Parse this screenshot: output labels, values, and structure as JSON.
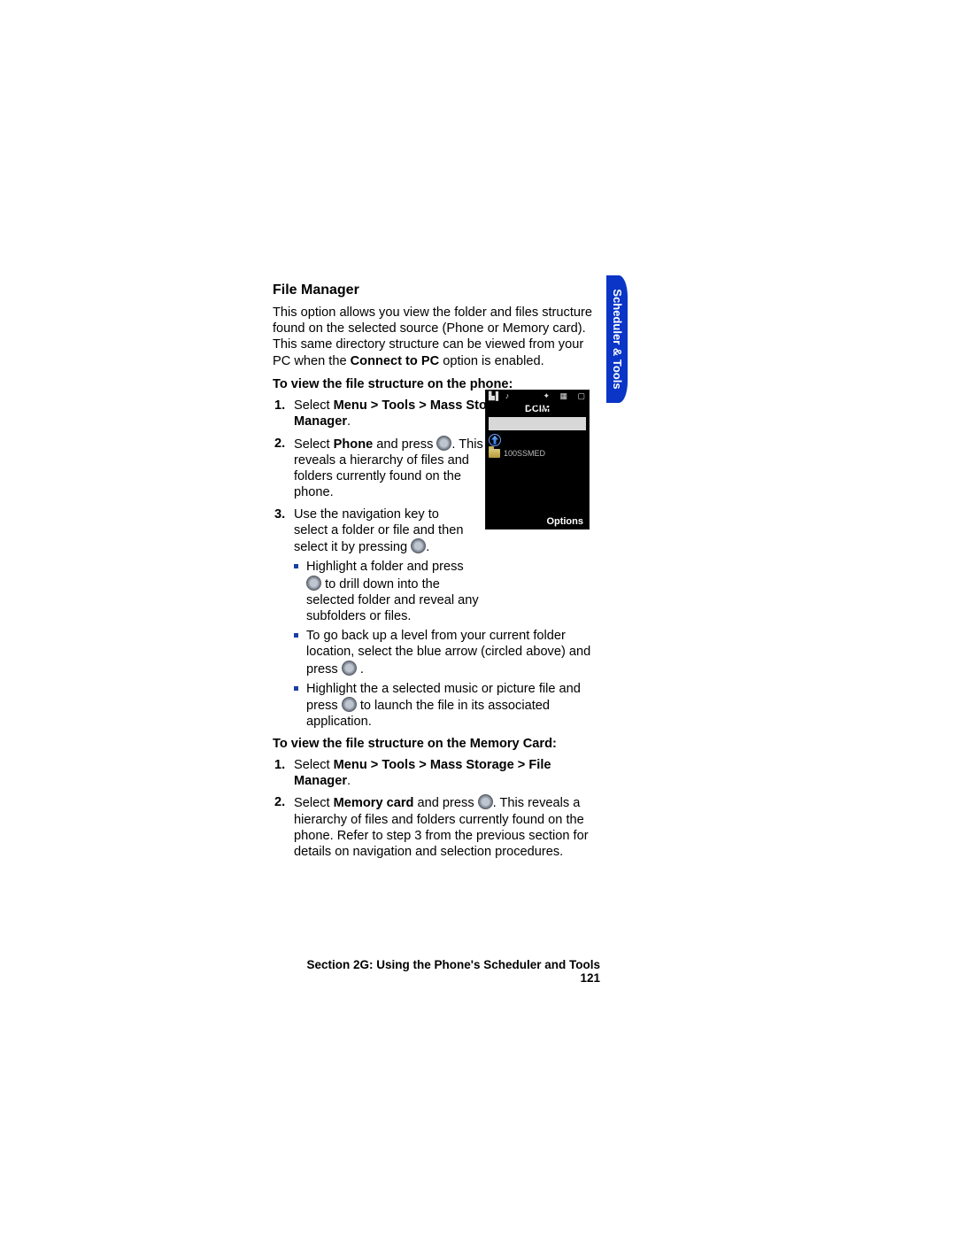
{
  "heading": "File Manager",
  "intro_part1": "This option allows you view the folder and files structure found on the selected source (Phone or Memory card). This same directory structure can be viewed from your PC when the ",
  "intro_bold": "Connect to PC",
  "intro_part2": " option is enabled.",
  "subhead_phone": "To view the file structure on the phone:",
  "steps_phone": {
    "s1": {
      "num": "1.",
      "pre": "Select ",
      "bold": "Menu > Tools > Mass Storage > File Manager",
      "post": "."
    },
    "s2": {
      "num": "2.",
      "pre": "Select ",
      "bold": "Phone",
      "mid": " and press ",
      "post": ". This reveals a hierarchy of files and folders currently found on the phone."
    },
    "s3": {
      "num": "3.",
      "pre": "Use the navigation key to select a folder or file and then select it by pressing ",
      "post": "."
    },
    "b1": {
      "pre": "Highlight a folder and press ",
      "post": " to drill down into the selected folder and reveal any subfolders or files."
    },
    "b2": {
      "pre": "To go back up a level from your current folder location, select the blue arrow (circled above) and press ",
      "post": "."
    },
    "b3": {
      "pre": "Highlight the a selected music or picture file and press ",
      "post": " to launch the file in its associated application."
    }
  },
  "subhead_card": "To view the file structure on the Memory Card:",
  "steps_card": {
    "s1": {
      "num": "1.",
      "pre": "Select ",
      "bold": "Menu > Tools > Mass Storage > File Manager",
      "post": "."
    },
    "s2": {
      "num": "2.",
      "pre": "Select ",
      "bold": "Memory card",
      "mid": " and press ",
      "post": ". This reveals a hierarchy of files and folders currently found on the phone. Refer to step 3 from the previous section for details on navigation and selection procedures."
    }
  },
  "phone_shot": {
    "title": "DCIM",
    "folder": "100SSMED",
    "options": "Options"
  },
  "side_tab": "Scheduler & Tools",
  "footer_section": "Section 2G: Using the Phone's Scheduler and Tools",
  "footer_page": "121"
}
